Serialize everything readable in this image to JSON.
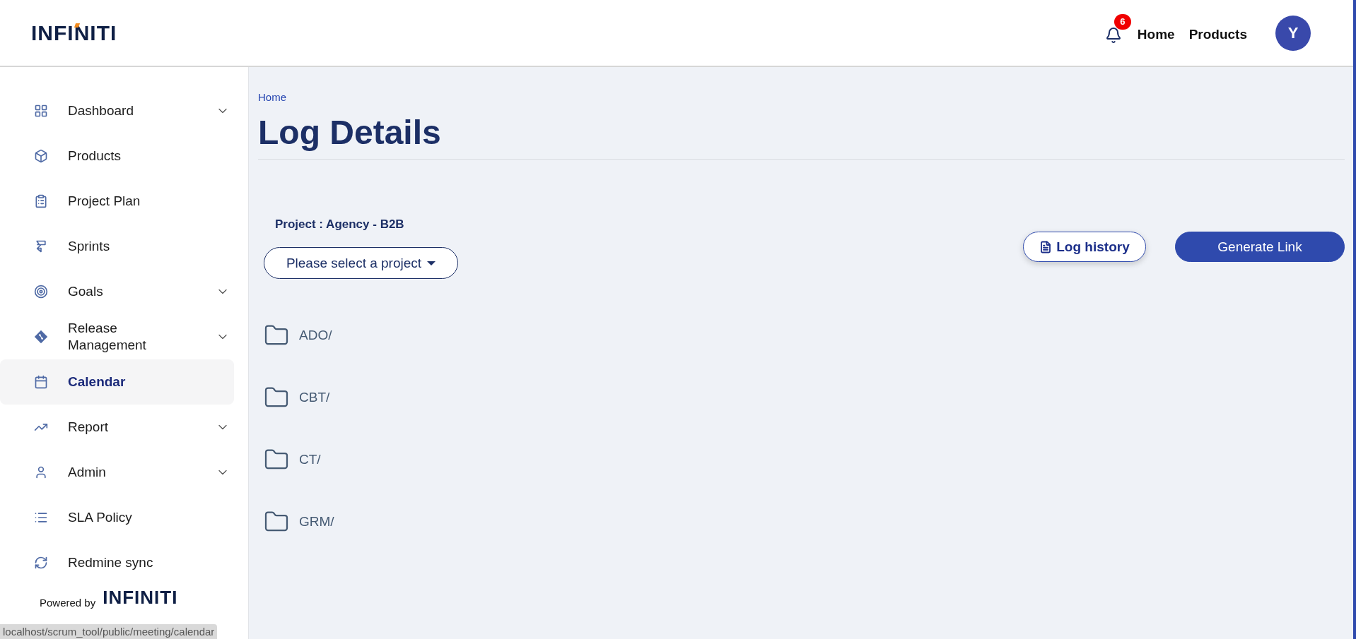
{
  "header": {
    "logo": "INFINITI",
    "notifications": {
      "count": "6"
    },
    "nav": [
      "Home",
      "Products"
    ],
    "avatar": "Y"
  },
  "sidebar": {
    "items": [
      {
        "label": "Dashboard",
        "expandable": true,
        "selected": false
      },
      {
        "label": "Products",
        "expandable": false,
        "selected": false
      },
      {
        "label": "Project Plan",
        "expandable": false,
        "selected": false
      },
      {
        "label": "Sprints",
        "expandable": false,
        "selected": false
      },
      {
        "label": "Goals",
        "expandable": true,
        "selected": false
      },
      {
        "label": "Release Management",
        "expandable": true,
        "selected": false
      },
      {
        "label": "Calendar",
        "expandable": false,
        "selected": true
      },
      {
        "label": "Report",
        "expandable": true,
        "selected": false
      },
      {
        "label": "Admin",
        "expandable": true,
        "selected": false
      },
      {
        "label": "SLA Policy",
        "expandable": false,
        "selected": false
      },
      {
        "label": "Redmine sync",
        "expandable": false,
        "selected": false
      }
    ],
    "powered_by": "Powered by",
    "powered_logo": "INFINITI"
  },
  "status_url": "localhost/scrum_tool/public/meeting/calendar",
  "main": {
    "breadcrumb": "Home",
    "title": "Log Details",
    "project_label": "Project : Agency - B2B",
    "project_select": {
      "placeholder": "Please select a project"
    },
    "buttons": [
      {
        "label": "Log history",
        "kind": "outline"
      },
      {
        "label": "Generate Link",
        "kind": "primary"
      }
    ],
    "folders": [
      "ADO/",
      "CBT/",
      "CT/",
      "GRM/"
    ]
  }
}
